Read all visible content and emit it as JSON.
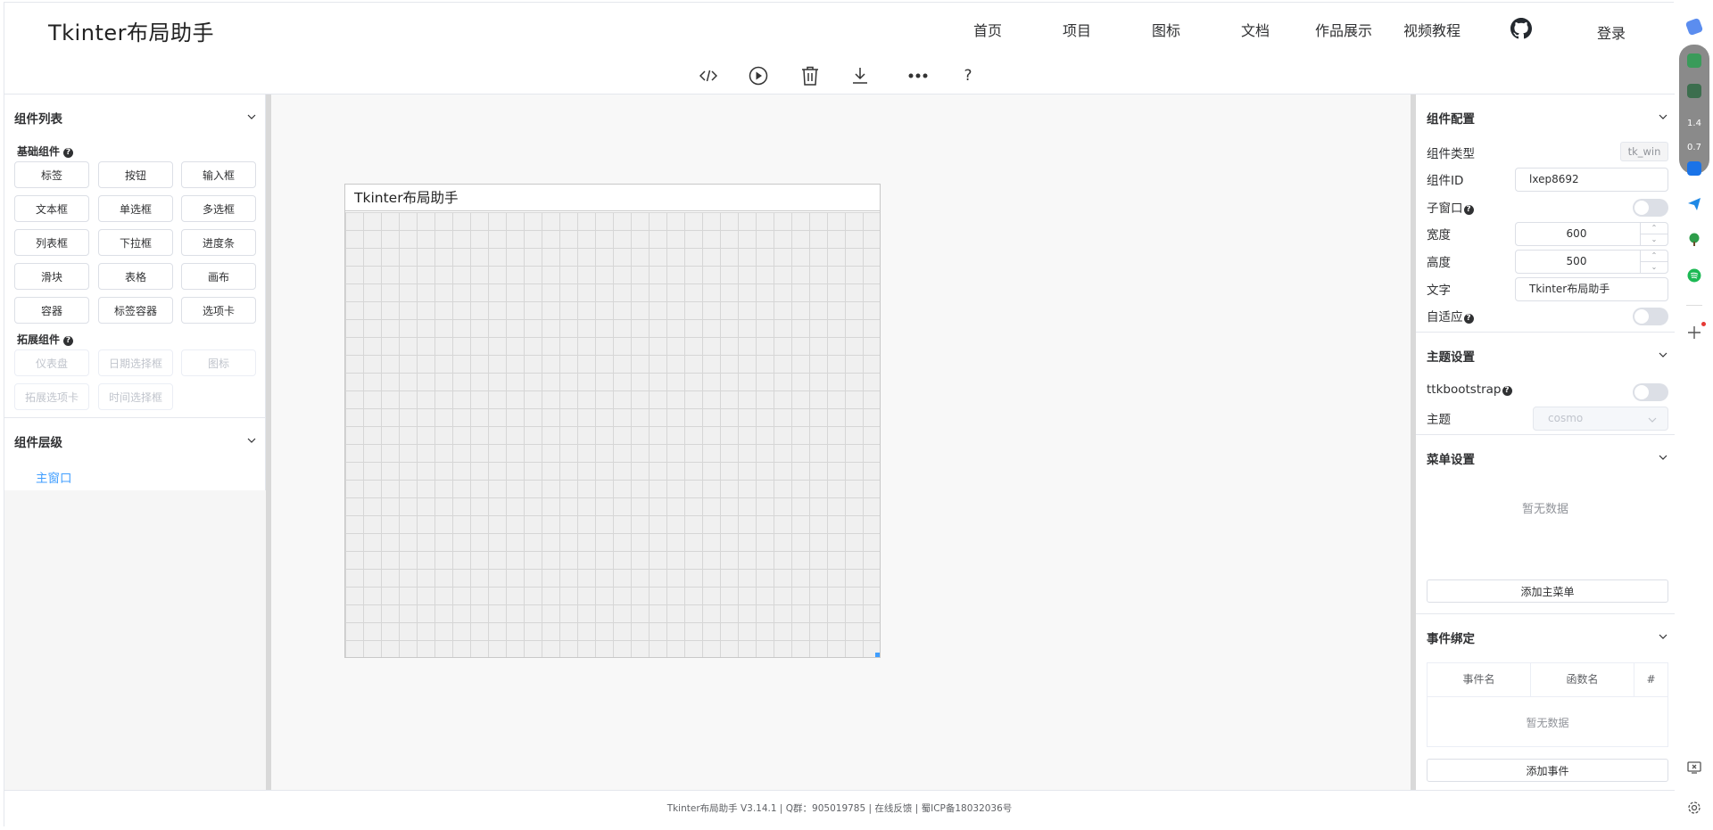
{
  "header": {
    "brand": "Tkinter布局助手",
    "nav": [
      "首页",
      "项目",
      "图标",
      "文档",
      "作品展示",
      "视频教程"
    ],
    "login": "登录"
  },
  "toolbar": {
    "icons": [
      "code-icon",
      "play-icon",
      "trash-icon",
      "download-icon",
      "more-icon",
      "help-icon"
    ],
    "help_label": "?"
  },
  "left": {
    "components_title": "组件列表",
    "basic_title": "基础组件",
    "basic": [
      "标签",
      "按钮",
      "输入框",
      "文本框",
      "单选框",
      "多选框",
      "列表框",
      "下拉框",
      "进度条",
      "滑块",
      "表格",
      "画布",
      "容器",
      "标签容器",
      "选项卡"
    ],
    "ext_title": "拓展组件",
    "ext": [
      "仪表盘",
      "日期选择框",
      "图标",
      "拓展选项卡",
      "时间选择框"
    ],
    "hierarchy_title": "组件层级",
    "hierarchy_root": "主窗口"
  },
  "canvas": {
    "window_title": "Tkinter布局助手"
  },
  "right": {
    "config_title": "组件配置",
    "type_label": "组件类型",
    "type_value": "tk_win",
    "id_label": "组件ID",
    "id_value": "lxep8692",
    "child_label": "子窗口",
    "child_on": false,
    "width_label": "宽度",
    "width_value": "600",
    "height_label": "高度",
    "height_value": "500",
    "text_label": "文字",
    "text_value": "Tkinter布局助手",
    "adaptive_label": "自适应",
    "adaptive_on": false,
    "theme_title": "主题设置",
    "ttk_label": "ttkbootstrap",
    "ttk_on": false,
    "theme_label": "主题",
    "theme_value": "cosmo",
    "menu_title": "菜单设置",
    "menu_empty": "暂无数据",
    "add_menu": "添加主菜单",
    "event_title": "事件绑定",
    "event_cols": [
      "事件名",
      "函数名",
      "#"
    ],
    "event_empty": "暂无数据",
    "add_event": "添加事件"
  },
  "footer": {
    "text": "Tkinter布局助手 V3.14.1 | Q群：905019785 | 在线反馈 | 蜀ICP备18032036号"
  },
  "side": {
    "stat1": "1.4",
    "stat2": "0.7"
  }
}
